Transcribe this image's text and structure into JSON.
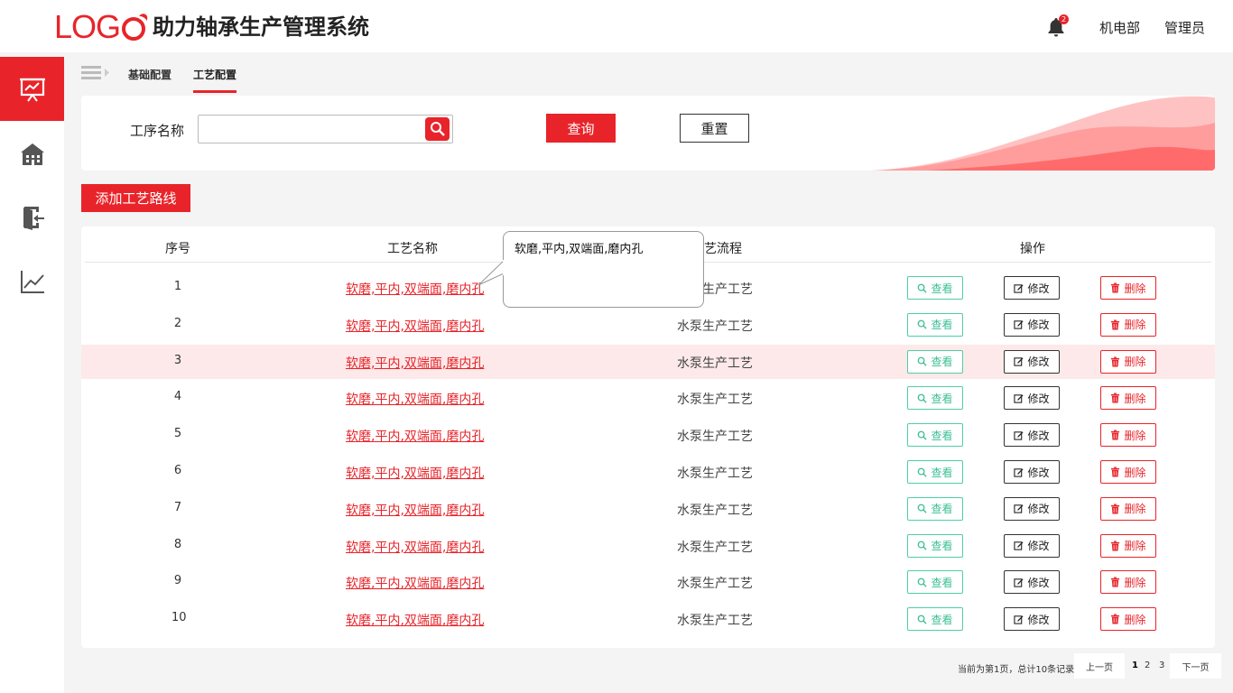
{
  "header": {
    "logo_text": "LOG",
    "system_title": "助力轴承生产管理系统",
    "notification_count": "2",
    "department": "机电部",
    "user_role": "管理员"
  },
  "sidebar": {
    "items": [
      {
        "name": "presentation-icon",
        "active": true
      },
      {
        "name": "building-icon",
        "active": false
      },
      {
        "name": "exit-icon",
        "active": false
      },
      {
        "name": "chart-icon",
        "active": false
      }
    ]
  },
  "breadcrumb": {
    "items": [
      "基础配置",
      "工艺配置"
    ],
    "active": "工艺配置"
  },
  "filter": {
    "label": "工序名称",
    "input_value": "",
    "query_label": "查询",
    "reset_label": "重置"
  },
  "add_button_label": "添加工艺路线",
  "table": {
    "columns": [
      "序号",
      "工艺名称",
      "工艺流程",
      "操作"
    ],
    "rows": [
      {
        "idx": "1",
        "name": "软磨,平内,双端面,磨内孔",
        "flow": "水泵生产工艺"
      },
      {
        "idx": "2",
        "name": "软磨,平内,双端面,磨内孔",
        "flow": "水泵生产工艺"
      },
      {
        "idx": "3",
        "name": "软磨,平内,双端面,磨内孔",
        "flow": "水泵生产工艺"
      },
      {
        "idx": "4",
        "name": "软磨,平内,双端面,磨内孔",
        "flow": "水泵生产工艺"
      },
      {
        "idx": "5",
        "name": "软磨,平内,双端面,磨内孔",
        "flow": "水泵生产工艺"
      },
      {
        "idx": "6",
        "name": "软磨,平内,双端面,磨内孔",
        "flow": "水泵生产工艺"
      },
      {
        "idx": "7",
        "name": "软磨,平内,双端面,磨内孔",
        "flow": "水泵生产工艺"
      },
      {
        "idx": "8",
        "name": "软磨,平内,双端面,磨内孔",
        "flow": "水泵生产工艺"
      },
      {
        "idx": "9",
        "name": "软磨,平内,双端面,磨内孔",
        "flow": "水泵生产工艺"
      },
      {
        "idx": "10",
        "name": "软磨,平内,双端面,磨内孔",
        "flow": "水泵生产工艺"
      }
    ],
    "highlighted_row": "3",
    "actions": {
      "view": "查看",
      "edit": "修改",
      "delete": "删除"
    }
  },
  "tooltip": {
    "text": "软磨,平内,双端面,磨内孔"
  },
  "pagination": {
    "info": "当前为第1页，总计10条记录",
    "prev": "上一页",
    "pages": [
      "1",
      "2",
      "3"
    ],
    "current": "1",
    "next": "下一页"
  },
  "colors": {
    "accent": "#e8242a",
    "view": "#3bbf96",
    "highlight_row": "#fde9e9",
    "background": "#f4f4f4"
  }
}
